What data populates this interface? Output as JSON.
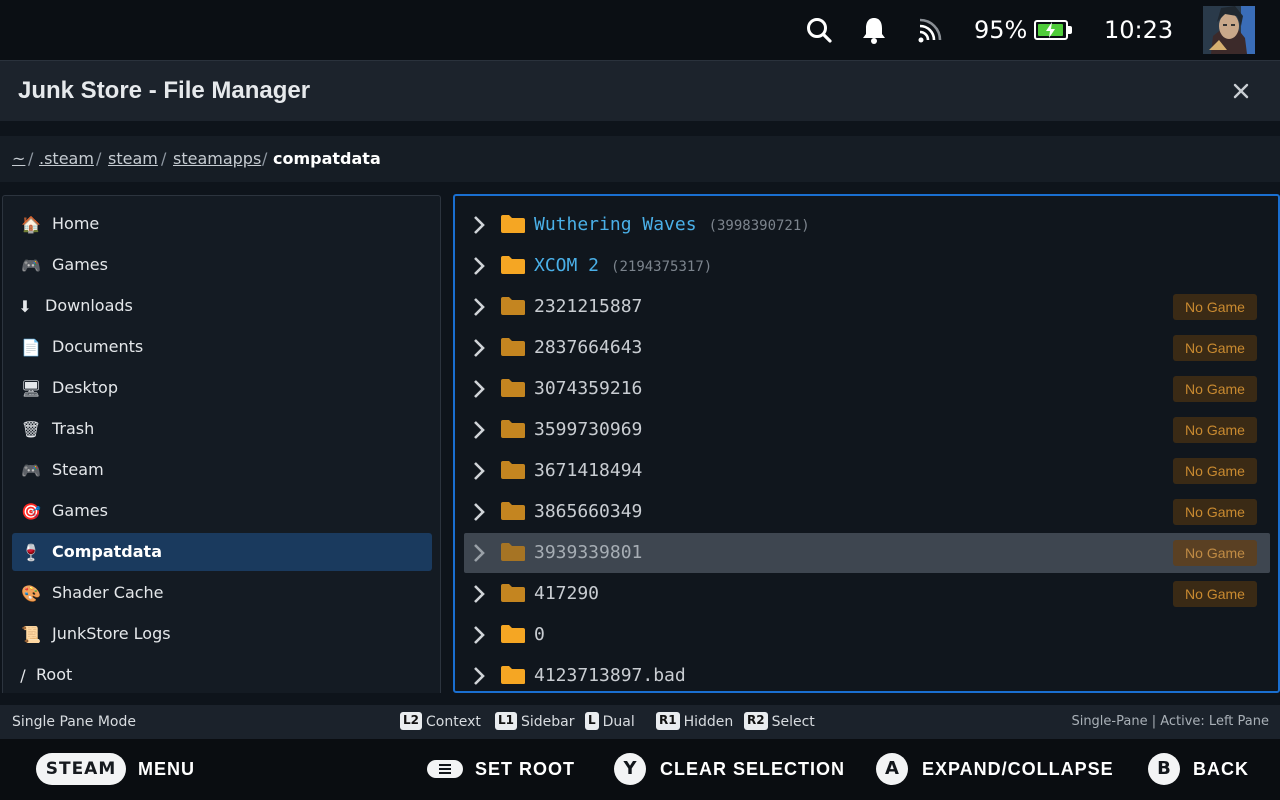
{
  "status_bar": {
    "icons": [
      "search-icon",
      "notification-bell-icon",
      "wifi-icon"
    ],
    "battery_percent": "95%",
    "battery_level": 0.95,
    "time": "10:23"
  },
  "window": {
    "title": "Junk Store - File Manager",
    "close_icon": "close-icon"
  },
  "breadcrumb": {
    "parts": [
      "~",
      ".steam",
      "steam",
      "steamapps"
    ],
    "current": "compatdata"
  },
  "sidebar": {
    "items": [
      {
        "label": "Home",
        "icon": "house-icon",
        "glyph": "🏠"
      },
      {
        "label": "Games",
        "icon": "gamepad-icon",
        "glyph": "🎮"
      },
      {
        "label": "Downloads",
        "icon": "download-arrow-icon",
        "glyph": "⬇"
      },
      {
        "label": "Documents",
        "icon": "document-icon",
        "glyph": "📄"
      },
      {
        "label": "Desktop",
        "icon": "monitor-icon",
        "glyph": "🖥"
      },
      {
        "label": "Trash",
        "icon": "trash-icon",
        "glyph": "🗑"
      },
      {
        "label": "Steam",
        "icon": "gamepad-icon",
        "glyph": "🎮"
      },
      {
        "label": "Games",
        "icon": "target-icon",
        "glyph": "🎯"
      },
      {
        "label": "Compatdata",
        "icon": "wine-glass-icon",
        "glyph": "🍷",
        "active": true
      },
      {
        "label": "Shader Cache",
        "icon": "palette-icon",
        "glyph": "🎨"
      },
      {
        "label": "JunkStore Logs",
        "icon": "scroll-icon",
        "glyph": "📜"
      },
      {
        "label": "Root",
        "icon": "slash-icon",
        "glyph": "/"
      }
    ]
  },
  "files": {
    "rows": [
      {
        "name": "Wuthering Waves",
        "id": "(3998390721)",
        "type": "game"
      },
      {
        "name": "XCOM 2",
        "id": "(2194375317)",
        "type": "game"
      },
      {
        "name": "2321215887",
        "badge": "No Game"
      },
      {
        "name": "2837664643",
        "badge": "No Game"
      },
      {
        "name": "3074359216",
        "badge": "No Game"
      },
      {
        "name": "3599730969",
        "badge": "No Game"
      },
      {
        "name": "3671418494",
        "badge": "No Game"
      },
      {
        "name": "3865660349",
        "badge": "No Game"
      },
      {
        "name": "3939339801",
        "badge": "No Game",
        "selected": true
      },
      {
        "name": "417290",
        "badge": "No Game"
      },
      {
        "name": "0"
      },
      {
        "name": "4123713897.bad"
      }
    ]
  },
  "hints": {
    "mode": "Single Pane Mode",
    "items": [
      {
        "key": "L2",
        "label": "Context"
      },
      {
        "key": "L1",
        "label": "Sidebar"
      },
      {
        "key": "L",
        "label": "Dual"
      },
      {
        "key": "R1",
        "label": "Hidden"
      },
      {
        "key": "R2",
        "label": "Select"
      }
    ],
    "status": "Single-Pane | Active: Left Pane"
  },
  "footer": {
    "steam_label": "STEAM",
    "menu_label": "MENU",
    "set_root_label": "SET ROOT",
    "y_button": "Y",
    "clear_selection_label": "CLEAR SELECTION",
    "a_button": "A",
    "expand_label": "EXPAND/COLLAPSE",
    "b_button": "B",
    "back_label": "BACK"
  },
  "colors": {
    "accent": "#1a6fd0",
    "sidebar_active": "#1a3a5e",
    "game_name": "#4ab0e8",
    "folder": "#f5a623",
    "folder_dim": "#c48520",
    "badge_text": "#c98a30"
  }
}
